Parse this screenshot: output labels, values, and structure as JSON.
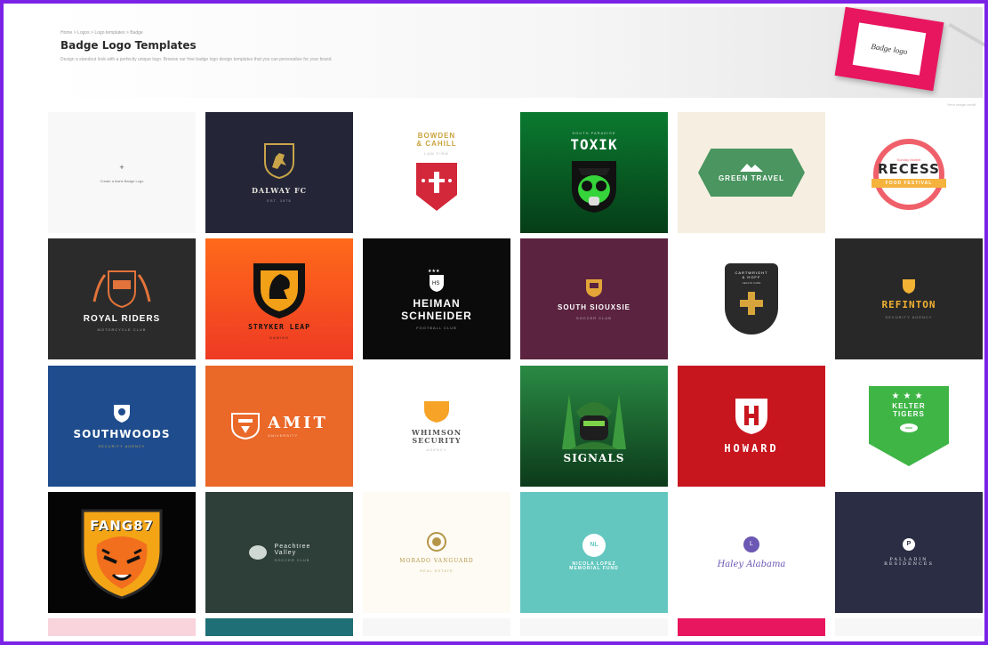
{
  "header": {
    "breadcrumb": "Home > Logos > Logo templates > Badge",
    "title": "Badge Logo Templates",
    "description": "Design a standout look with a perfectly unique logo. Browse our free badge logo design templates that you can personalize for your brand."
  },
  "hero_card_text": "Badge logo",
  "credit": "Hero image credit",
  "create_tile": {
    "plus": "+",
    "label": "Create a blank Badge Logo"
  },
  "templates": {
    "dalway": {
      "name": "DALWAY FC",
      "tag": "EST. 1976"
    },
    "bowden": {
      "name_line1": "BOWDEN",
      "name_line2": "& CAHILL",
      "tag": "LAW FIRM"
    },
    "toxik": {
      "top": "SOUTH PARADISE",
      "name": "TOXIK"
    },
    "greentravel": {
      "name": "GREEN TRAVEL"
    },
    "recess": {
      "top": "Sunday Market",
      "name": "RECESS",
      "ribbon": "FOOD FESTIVAL"
    },
    "royal": {
      "name": "ROYAL RIDERS",
      "tag": "MOTORCYCLE CLUB"
    },
    "stryker": {
      "name": "STRYKER LEAP",
      "tag": "GAMING"
    },
    "heiman": {
      "line1": "HEIMAN",
      "line2": "SCHNEIDER",
      "tag": "FOOTBALL CLUB"
    },
    "southsiouxsie": {
      "name": "SOUTH SIOUXSIE",
      "tag": "SOCCER CLUB"
    },
    "cartwright": {
      "line1": "CARTWRIGHT",
      "line2": "& HOFF",
      "tag": "HEALTH CARE"
    },
    "refinton": {
      "name": "REFINTON",
      "tag": "SECURITY AGENCY"
    },
    "southwoods": {
      "name": "SOUTHWOODS",
      "tag": "SECURITY AGENCY"
    },
    "amit": {
      "name": "AMIT",
      "tag": "UNIVERSITY"
    },
    "whimson": {
      "line1": "WHIMSON",
      "line2": "SECURITY",
      "tag": "AGENCY"
    },
    "signals": {
      "name": "SIGNALS"
    },
    "howard": {
      "name": "HOWARD"
    },
    "kelter": {
      "line1": "KELTER",
      "line2": "TIGERS"
    },
    "fang": {
      "name": "FANG87"
    },
    "peachtree": {
      "line1": "Peachtree",
      "line2": "Valley",
      "tag": "SOCCER CLUB"
    },
    "morado": {
      "name": "MORADO VANGUARD",
      "tag": "REAL ESTATE"
    },
    "nicola": {
      "badge": "NL",
      "line1": "NICOLA LOPEZ",
      "line2": "MEMORIAL FUND"
    },
    "haley": {
      "badge": "L",
      "name": "Haley Alabama"
    },
    "palladin": {
      "badge": "P",
      "line1": "PALLADIN",
      "line2": "RESIDENCES"
    }
  },
  "colors": {
    "frame": "#7a22e6",
    "dalway_bg": "#242638",
    "toxik_bg": "#0f6f2c",
    "greentravel_bg": "#f6efe1",
    "royal_bg": "#2b2b2b",
    "stryker_bg": "#f2501e",
    "heiman_bg": "#0b0b0b",
    "southsiouxsie_bg": "#5b2340",
    "refinton_bg": "#282828",
    "southwoods_bg": "#1e4c8d",
    "amit_bg": "#ea6828",
    "signals_bg": "#1a6a36",
    "howard_bg": "#c8161f",
    "fang_bg": "#050505",
    "peachtree_bg": "#2e3f3a",
    "morado_bg": "#fdfbf3",
    "nicola_bg": "#63c7bf",
    "palladin_bg": "#2b2d44"
  }
}
